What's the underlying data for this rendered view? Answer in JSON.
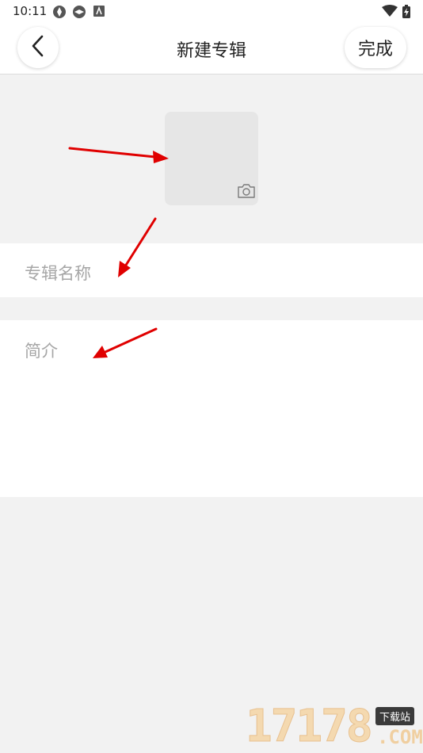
{
  "status_bar": {
    "time": "10:11",
    "icons": [
      "sync-icon",
      "sync-icon",
      "android-notification-icon",
      "wifi-icon",
      "battery-charging-icon"
    ]
  },
  "header": {
    "title": "新建专辑",
    "back_icon": "chevron-left-icon",
    "done_label": "完成"
  },
  "cover": {
    "icon": "camera-icon"
  },
  "form": {
    "name_placeholder": "专辑名称",
    "intro_placeholder": "简介"
  },
  "watermark": {
    "digits": "17178",
    "badge": "下载站",
    "domain": ".COM"
  },
  "colors": {
    "background": "#f2f2f2",
    "surface": "#ffffff",
    "placeholder": "#a6a6a6",
    "annotation_arrow": "#e00000"
  }
}
